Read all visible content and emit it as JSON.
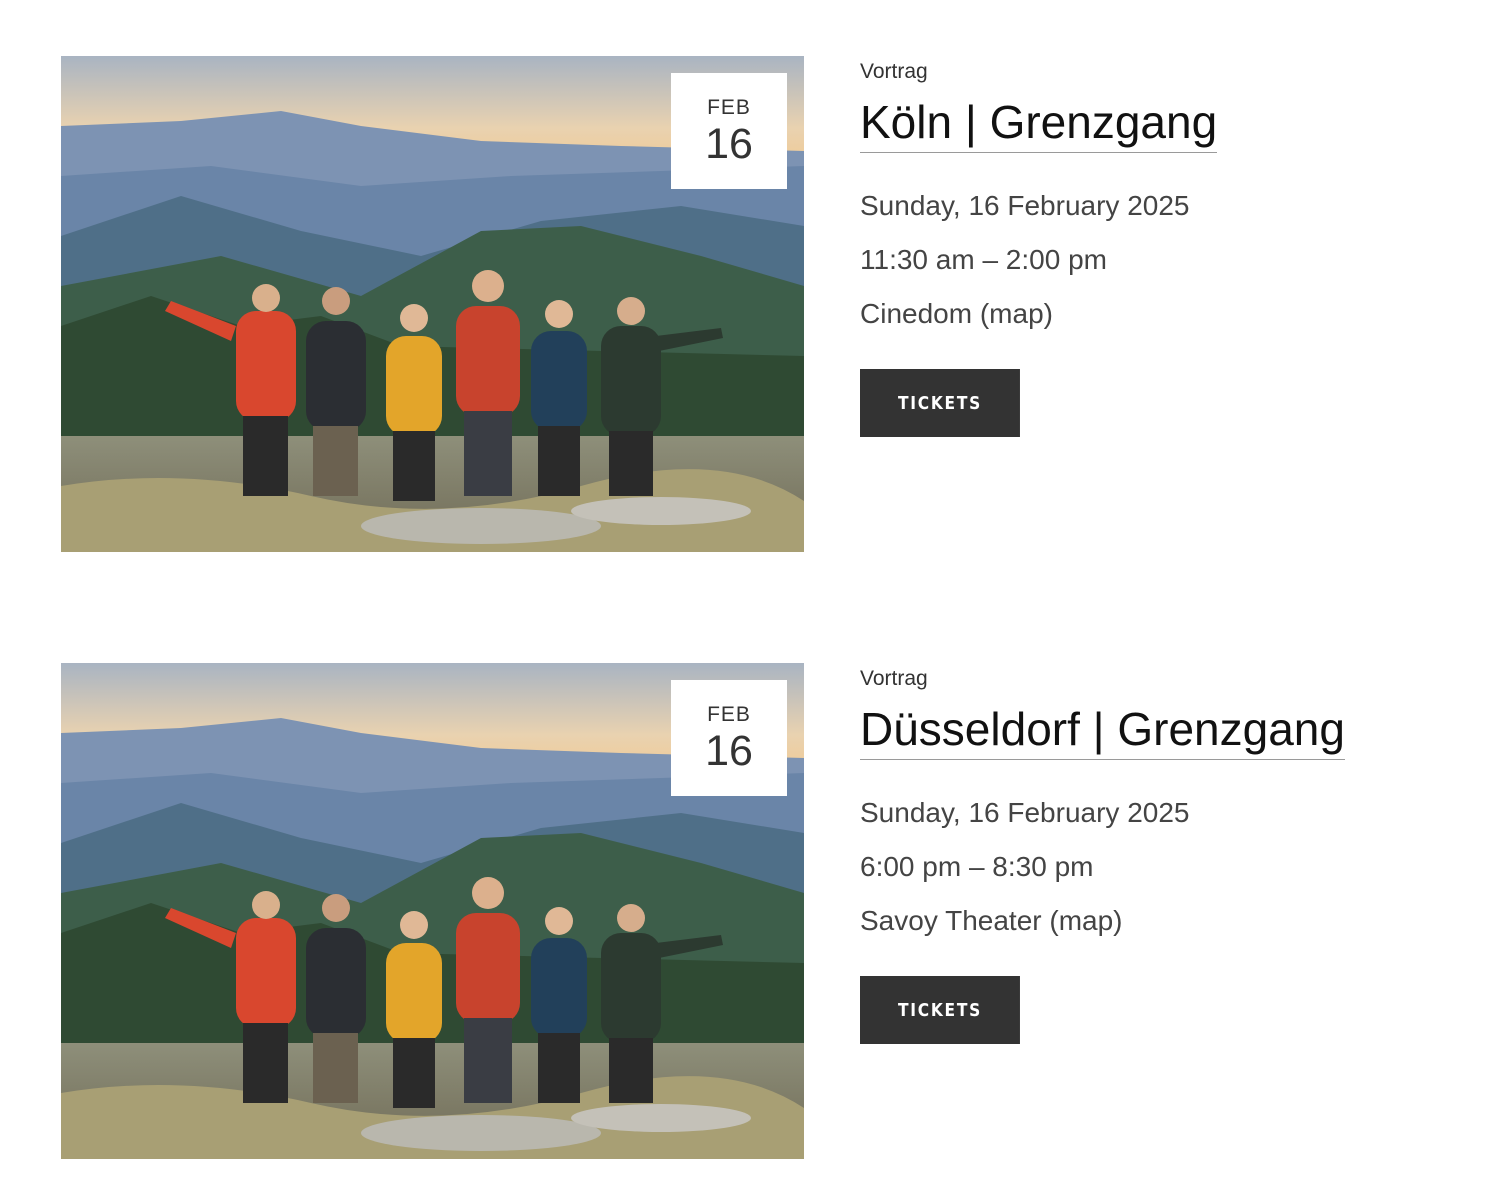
{
  "events": [
    {
      "category": "Vortrag",
      "title": "Köln | Grenzgang",
      "badge": {
        "month": "FEB",
        "day": "16"
      },
      "date": "Sunday, 16 February 2025",
      "time": "11:30 am – 2:00 pm",
      "venue": "Cinedom",
      "map_link": "(map)",
      "tickets_label": "Tickets"
    },
    {
      "category": "Vortrag",
      "title": "Düsseldorf | Grenzgang",
      "badge": {
        "month": "FEB",
        "day": "16"
      },
      "date": "Sunday, 16 February 2025",
      "time": "6:00 pm – 8:30 pm",
      "venue": "Savoy Theater",
      "map_link": "(map)",
      "tickets_label": "Tickets"
    }
  ],
  "image": {
    "subject": "group-of-hikers-on-mountain-ridge-photo"
  },
  "colors": {
    "button_bg": "#333333",
    "button_text": "#ffffff",
    "badge_bg": "#ffffff",
    "title_text": "#111111"
  }
}
